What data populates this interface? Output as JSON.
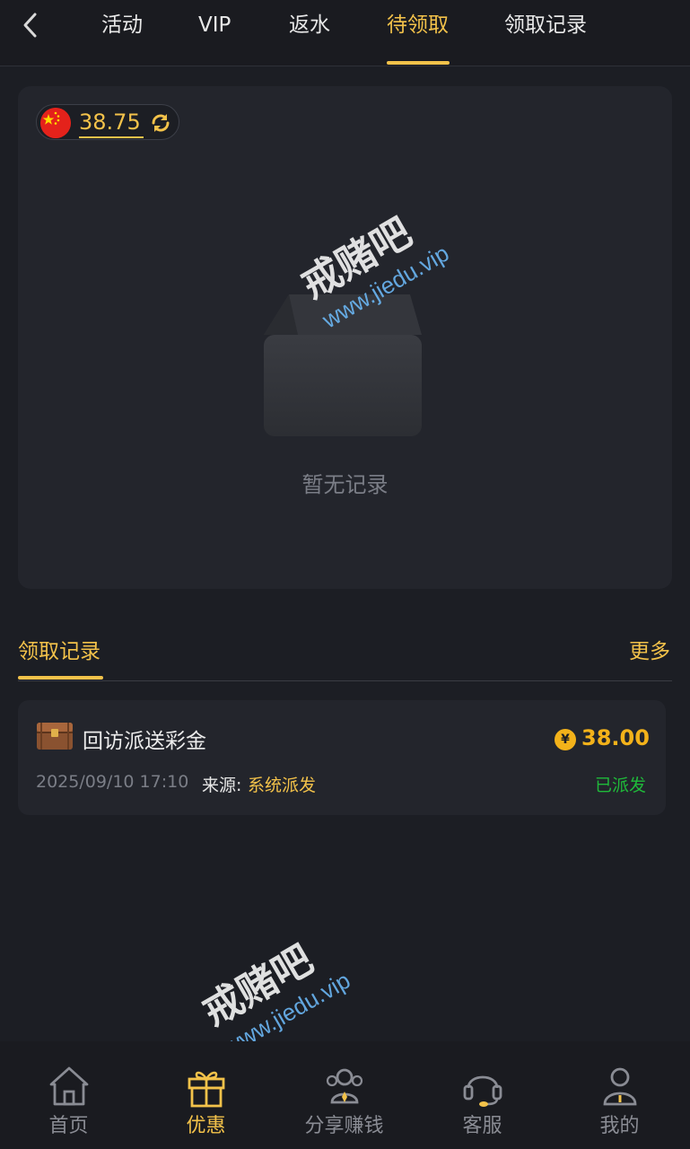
{
  "topnav": {
    "tabs": [
      {
        "label": "活动"
      },
      {
        "label": "VIP"
      },
      {
        "label": "返水"
      },
      {
        "label": "待领取",
        "active": true
      },
      {
        "label": "领取记录"
      }
    ]
  },
  "pending": {
    "balance": "38.75",
    "empty_text": "暂无记录"
  },
  "records": {
    "title": "领取记录",
    "more": "更多",
    "items": [
      {
        "title": "回访派送彩金",
        "date": "2025/09/10 17:10",
        "source_label": "来源:",
        "source_value": "系统派发",
        "currency_symbol": "¥",
        "amount": "38.00",
        "status": "已派发"
      }
    ]
  },
  "watermark": {
    "brand": "戒赌吧",
    "url": "www.jiedu.vip"
  },
  "bottomnav": {
    "items": [
      {
        "label": "首页"
      },
      {
        "label": "优惠",
        "active": true
      },
      {
        "label": "分享赚钱"
      },
      {
        "label": "客服"
      },
      {
        "label": "我的"
      }
    ]
  },
  "colors": {
    "accent": "#f3c24a",
    "background": "#1c1e24",
    "card": "#23252c",
    "status_green": "#1fba3a"
  }
}
